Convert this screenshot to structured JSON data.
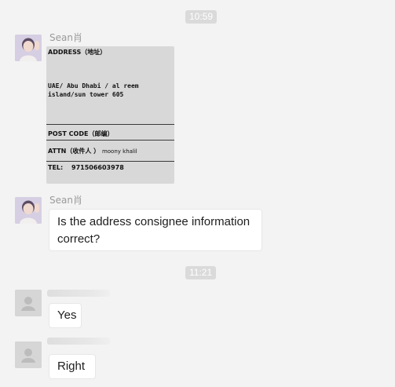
{
  "timestamps": [
    "10:59",
    "11:21"
  ],
  "messages": {
    "m1": {
      "sender": "Sean肖",
      "card": {
        "address_label": "ADDRESS（地址）",
        "address_line1": "UAE/ Abu Dhabi / al reem",
        "address_line2": "island/sun tower 605",
        "postcode_label": "POST CODE（邮编）",
        "attn_label": "ATTN（收件人 ）",
        "attn_value": "moony khalil",
        "tel_label": "TEL:",
        "tel_value": "971506603978"
      }
    },
    "m2": {
      "sender": "Sean肖",
      "text_line1": "Is the address consignee information",
      "text_line2": "correct?"
    },
    "m3": {
      "text": "Yes"
    },
    "m4": {
      "text": "Right"
    }
  }
}
